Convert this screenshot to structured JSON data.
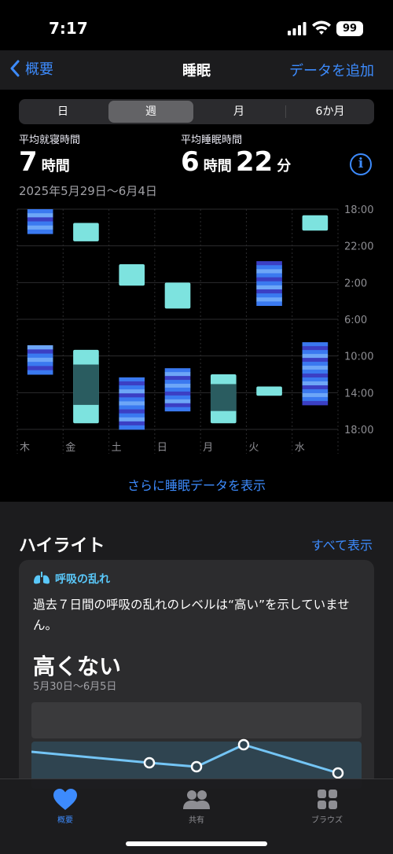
{
  "status": {
    "time": "7:17",
    "battery": "99"
  },
  "nav": {
    "back_label": "概要",
    "title": "睡眠",
    "action_label": "データを追加"
  },
  "segments": [
    {
      "label": "日",
      "active": false
    },
    {
      "label": "週",
      "active": true
    },
    {
      "label": "月",
      "active": false
    },
    {
      "label": "6か月",
      "active": false
    }
  ],
  "stats": {
    "bedtime_label": "平均就寝時間",
    "bedtime_hours": "7",
    "bedtime_hours_unit": "時間",
    "sleep_label": "平均睡眠時間",
    "sleep_hours": "6",
    "sleep_hours_unit": "時間",
    "sleep_minutes": "22",
    "sleep_minutes_unit": "分",
    "info_icon": "i",
    "date_range": "2025年5月29日〜6月4日"
  },
  "chart_data": {
    "type": "range-bar",
    "y_ticks": [
      "18:00",
      "22:00",
      "2:00",
      "6:00",
      "10:00",
      "14:00",
      "18:00"
    ],
    "days": [
      "木",
      "金",
      "土",
      "日",
      "月",
      "火",
      "水"
    ],
    "colors": {
      "in_bed": "#7de3df",
      "in_bed_dark": "#2a5c60",
      "asleep_core": "#3a79f0",
      "asleep_deep": "#3b3fc4",
      "asleep_light": "#6da6f7",
      "awake": "#e0554b"
    },
    "sessions": [
      {
        "day": "木",
        "start": "18:00",
        "end": "20:40",
        "kind": "asleep"
      },
      {
        "day": "木",
        "end": "12:00",
        "start": "08:50",
        "kind": "asleep"
      },
      {
        "day": "金",
        "start": "19:30",
        "end": "21:30",
        "kind": "in_bed"
      },
      {
        "day": "金",
        "start": "09:20",
        "end": "16:80",
        "kind": "in_bed"
      },
      {
        "day": "土",
        "start": "00:00",
        "end": "02:20",
        "kind": "in_bed"
      },
      {
        "day": "土",
        "start": "12:20",
        "end": "18:00",
        "kind": "asleep"
      },
      {
        "day": "日",
        "start": "02:00",
        "end": "04:50",
        "kind": "in_bed"
      },
      {
        "day": "日",
        "start": "11:20",
        "end": "16:00",
        "kind": "asleep"
      },
      {
        "day": "月",
        "start": "11:60",
        "end": "17:20",
        "kind": "in_bed"
      },
      {
        "day": "火",
        "start": "23:40",
        "end": "03:90",
        "kind": "asleep"
      },
      {
        "day": "火",
        "start": "12:80",
        "end": "14:20",
        "kind": "in_bed"
      },
      {
        "day": "水",
        "start": "18:40",
        "end": "20:20",
        "kind": "in_bed"
      },
      {
        "day": "水",
        "start": "07:90",
        "end": "15:20",
        "kind": "asleep"
      }
    ]
  },
  "more_link": "さらに睡眠データを表示",
  "highlights": {
    "title": "ハイライト",
    "show_all": "すべて表示",
    "card": {
      "category": "呼吸の乱れ",
      "body": "過去７日間の呼吸の乱れのレベルは“高い”を示していません。",
      "value": "高くない",
      "date": "5月30日〜6月5日"
    }
  },
  "tabbar": [
    {
      "label": "概要",
      "icon": "heart-icon",
      "active": true
    },
    {
      "label": "共有",
      "icon": "people-icon",
      "active": false
    },
    {
      "label": "ブラウズ",
      "icon": "grid-icon",
      "active": false
    }
  ]
}
